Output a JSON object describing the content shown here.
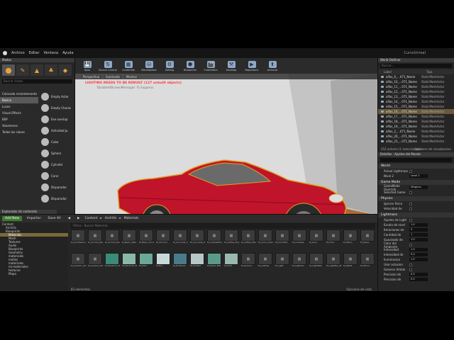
{
  "menu": [
    "Archivo",
    "Editar",
    "Ventana",
    "Ayuda"
  ],
  "window_title": "CursoUnreal",
  "modes": {
    "tab": "Modos",
    "search_placeholder": "Buscar clases",
    "categories": [
      "Colocado recientemente",
      "Basico",
      "Luces",
      "Visual Effects",
      "BSP",
      "Volumenes",
      "Todas las clases"
    ],
    "selected_category": 1,
    "items": [
      "Empty Actor",
      "Empty Charac",
      "Ese overlap",
      "Actividad Ju",
      "Cubo",
      "Sphere",
      "Cylinder",
      "Cone",
      "Disparador",
      "Disparador"
    ]
  },
  "toolbar": [
    "Save",
    "Source Control",
    "Contenido",
    "Marketplace",
    "Setting",
    "Blueprints",
    "Cinematics",
    "Develop",
    "Reproducir",
    "Arrancar"
  ],
  "viewport": {
    "tabs": [
      "Perspectiva",
      "Iluminado",
      "Mostrar"
    ],
    "warning": "LIGHTING NEEDS TO BE REBUILT (127 unbuilt objects)",
    "warning_sub": "'DisableAllScreenMessages' To Suppress",
    "corner_label": "Nivel: Nuevo transparente"
  },
  "outliner": {
    "tab": "World Outliner",
    "search_placeholder": "Buscar...",
    "col_label": "Label",
    "col_type": "Tipo",
    "rows": [
      {
        "label": "alfas_0_...071_Name",
        "type": "StaticMeshActor"
      },
      {
        "label": "alfas_10_...071_Name",
        "type": "StaticMeshActor"
      },
      {
        "label": "alfas_11_...071_Name",
        "type": "StaticMeshActor"
      },
      {
        "label": "alfas_12_...071_Name",
        "type": "StaticMeshActor"
      },
      {
        "label": "alfas_13_...071_Name",
        "type": "StaticMeshActor"
      },
      {
        "label": "alfas_14_...071_Name",
        "type": "StaticMeshActor"
      },
      {
        "label": "alfas_15_...071_Name",
        "type": "StaticMeshActor"
      },
      {
        "label": "alfas_16_...071_Name",
        "type": "StaticMeshActor"
      },
      {
        "label": "alfas_17_...071_Name",
        "type": "StaticMeshActor"
      },
      {
        "label": "alfas_18_...071_Name",
        "type": "StaticMeshActor"
      },
      {
        "label": "alfas_19_...071_Name",
        "type": "StaticMeshActor"
      },
      {
        "label": "alfas_2_...071_Name",
        "type": "StaticMeshActor"
      },
      {
        "label": "alfas_20_...071_Name",
        "type": "StaticMeshActor"
      },
      {
        "label": "alfas_21_...071_Name",
        "type": "StaticMeshActor"
      }
    ],
    "selected_row": 7,
    "footer": "252 actores (1 seleccionado)",
    "footer_right": "Opciones de visualizacion"
  },
  "details": {
    "tab": "Detalles",
    "tab2": "Ajustes del Mundo",
    "sections": [
      {
        "title": "World",
        "props": [
          {
            "label": "Actual Lightmass",
            "value": ""
          },
          {
            "label": "Nivel 2",
            "value": "Level 2"
          }
        ]
      },
      {
        "title": "Game Mode",
        "props": [
          {
            "label": "GameMode Override",
            "value": "Ninguno"
          },
          {
            "label": "Selected Game",
            "value": ""
          }
        ]
      },
      {
        "title": "Physics",
        "props": [
          {
            "label": "Ignorar fisica",
            "value": ""
          },
          {
            "label": "Velocidad de",
            "value": ""
          }
        ]
      },
      {
        "title": "Lightmass",
        "props": [
          {
            "label": "Ajustes de Light",
            "value": ""
          },
          {
            "label": "Escala de nivel",
            "value": "1.0"
          },
          {
            "label": "Iteraciones de",
            "value": "3"
          },
          {
            "label": "Cantidad de",
            "value": "1"
          },
          {
            "label": "Suavizado de",
            "value": "1.0"
          },
          {
            "label": "Color del Ambiente",
            "value": ""
          },
          {
            "label": "Intensidad",
            "value": "1.0"
          },
          {
            "label": "Intensidad de",
            "value": "0.0"
          },
          {
            "label": "Iluminacion",
            "value": "1.0"
          },
          {
            "label": "Usar oclusion",
            "value": ""
          },
          {
            "label": "Generar Ambie",
            "value": ""
          },
          {
            "label": "Precision de",
            "value": "0.5"
          },
          {
            "label": "Precision de",
            "value": "0.5"
          }
        ]
      }
    ]
  },
  "content_browser": {
    "tab": "Explorador de contenido",
    "add_new": "Add New",
    "import": "Importar",
    "save_all": "Save All",
    "path": [
      "Content",
      "ArchVis",
      "Materials"
    ],
    "filter_label": "Filtros",
    "search_placeholder": "Buscar Materials",
    "tree": [
      "Content",
      "ArchVis",
      "Blueprints",
      "Materials",
      "Mesh",
      "Textures",
      "Audio",
      "Blueprints",
      "Geometry",
      "materiales",
      "mallas",
      "materiales",
      "mi-materiales",
      "texturas",
      "Mapa"
    ],
    "selected_tree": 3,
    "assets": [
      "M_Architectural",
      "M_Archviz_Base",
      "M_Archviz_Shader",
      "M_Basic_Wall",
      "M_Basic_Floor",
      "M_Chrome",
      "M_Concrete_Tiles",
      "M_Concrete_Poured",
      "M_CobbleStone",
      "M_Coffee_Mug",
      "M_Coffee_Wood",
      "M_Color_Chair",
      "M_ColorTile",
      "M_Cooktop",
      "M_Door",
      "M_Floor",
      "M_Fabric",
      "M_Glass",
      "M_Custom_Tile",
      "M_Custom_Wall",
      "M_Desierto_M",
      "M_Desierto_Wall",
      "M_Dark",
      "M_Env",
      "M_Emissive",
      "M_Frosted",
      "M_Glass_Mat",
      "M_Gold",
      "M_Ground",
      "M_Leather",
      "M_Light",
      "M_Lightbox",
      "M_LightWall",
      "M_LightBox_Max",
      "M_Metal",
      "M_Mirror"
    ],
    "footer": "83 elementos",
    "footer_right": "Opciones de vista"
  }
}
